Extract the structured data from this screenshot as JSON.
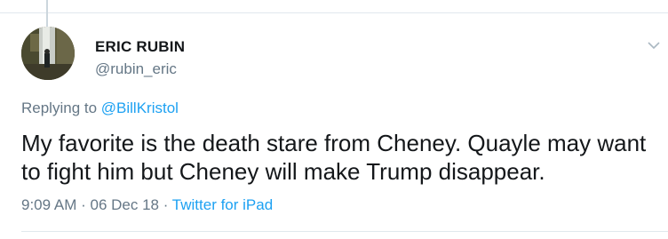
{
  "tweet": {
    "display_name": "ERIC RUBIN",
    "handle": "@rubin_eric",
    "replying_prefix": "Replying to ",
    "replying_to": "@BillKristol",
    "text": "My favorite is the death stare from Cheney. Quayle may want to fight him but Cheney will make Trump disappear.",
    "time": "9:09 AM",
    "separator": " · ",
    "date": "06 Dec 18",
    "source": "Twitter for iPad"
  },
  "colors": {
    "text_primary": "#14171a",
    "text_secondary": "#657786",
    "accent": "#1da1f2",
    "divider": "#e1e8ed"
  },
  "icons": {
    "menu": "chevron-down-icon",
    "avatar": "avatar"
  }
}
